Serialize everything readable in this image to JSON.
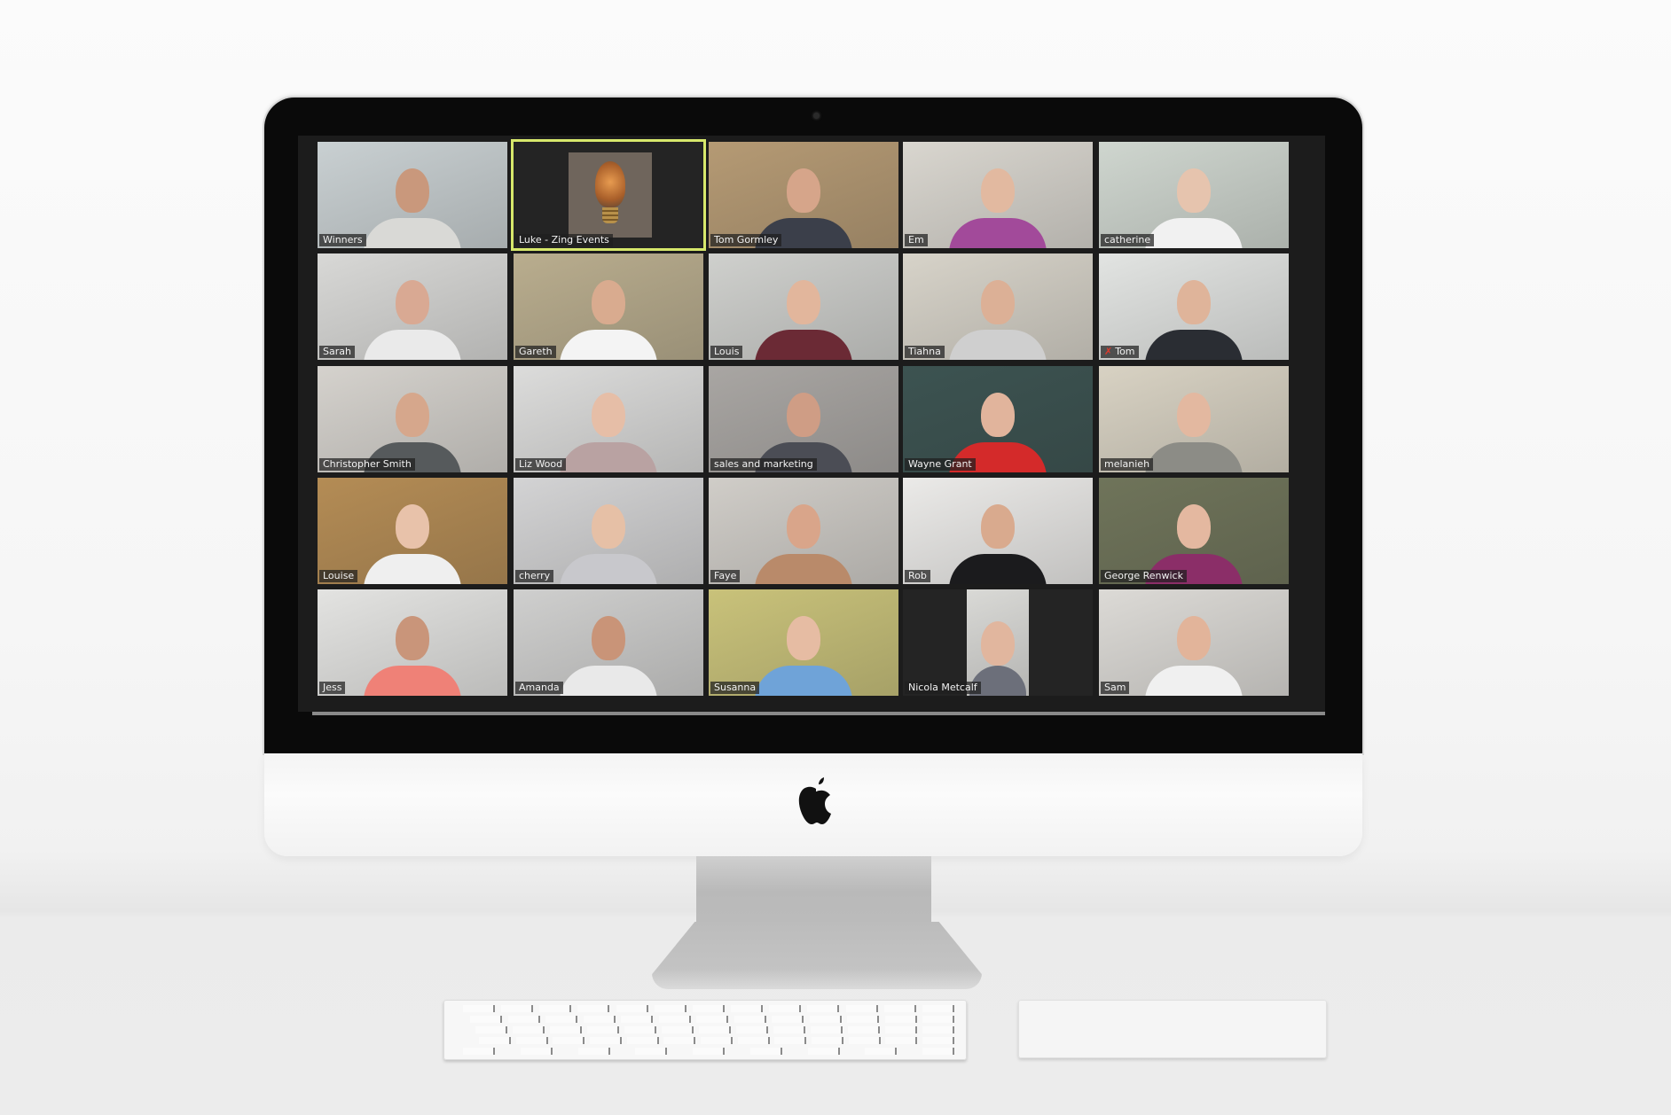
{
  "app": {
    "name": "Zoom meeting gallery view",
    "active_speaker": "Luke - Zing Events",
    "accent_color": "#d7e86b",
    "muted_icon_color": "#e0392b"
  },
  "participants": [
    {
      "name": "Winners",
      "muted": false,
      "bg": "#c9d0d2",
      "skin": "#c9987c",
      "shirt": "#d9d9d6"
    },
    {
      "name": "Luke - Zing Events",
      "muted": false,
      "active_speaker": true,
      "avatar": "lightbulb-image"
    },
    {
      "name": "Tom Gormley",
      "muted": false,
      "bg": "#b59a74",
      "skin": "#d6a58a",
      "shirt": "#3b3f4a"
    },
    {
      "name": "Em",
      "muted": false,
      "bg": "#d9d6cf",
      "skin": "#e2b9a0",
      "shirt": "#a24a9a"
    },
    {
      "name": "catherine",
      "muted": false,
      "bg": "#cfd6cf",
      "skin": "#e6c4ae",
      "shirt": "#f1f1f1"
    },
    {
      "name": "Sarah",
      "muted": false,
      "bg": "#d8d8d6",
      "skin": "#d9a993",
      "shirt": "#eaeaea"
    },
    {
      "name": "Gareth",
      "muted": false,
      "bg": "#b9ad8e",
      "skin": "#d9ab8f",
      "shirt": "#f4f4f4"
    },
    {
      "name": "Louis",
      "muted": false,
      "bg": "#cfd0cd",
      "skin": "#e2b69c",
      "shirt": "#6b2a35"
    },
    {
      "name": "Tiahna",
      "muted": false,
      "bg": "#d7d3c9",
      "skin": "#dcb096",
      "shirt": "#cfcfcf"
    },
    {
      "name": "Tom",
      "muted": true,
      "bg": "#e2e4e2",
      "skin": "#dfb49a",
      "shirt": "#2a2d33"
    },
    {
      "name": "Christopher Smith",
      "muted": false,
      "bg": "#d5d2cd",
      "skin": "#d6a78c",
      "shirt": "#565a5c"
    },
    {
      "name": "Liz Wood",
      "muted": false,
      "bg": "#dcdcdb",
      "skin": "#e6bea7",
      "shirt": "#b9a2a2"
    },
    {
      "name": "sales and marketing",
      "muted": false,
      "bg": "#a9a6a3",
      "skin": "#cf9d85",
      "shirt": "#4b4d55"
    },
    {
      "name": "Wayne Grant",
      "muted": false,
      "bg": "#3c5351",
      "skin": "#e1b49c",
      "shirt": "#d42a2a"
    },
    {
      "name": "melanieh",
      "muted": false,
      "bg": "#d8d2c3",
      "skin": "#e3b8a0",
      "shirt": "#8c8c86"
    },
    {
      "name": "Louise",
      "muted": false,
      "bg": "#b48c55",
      "skin": "#e8c2aa",
      "shirt": "#efefef"
    },
    {
      "name": "cherry",
      "muted": false,
      "bg": "#d3d3d4",
      "skin": "#e6c0a6",
      "shirt": "#c8c8cc"
    },
    {
      "name": "Faye",
      "muted": false,
      "bg": "#d0cdc8",
      "skin": "#d9a58a",
      "shirt": "#b98a6a"
    },
    {
      "name": "Rob",
      "muted": false,
      "bg": "#ebeae8",
      "skin": "#d9aa8e",
      "shirt": "#1b1b1d"
    },
    {
      "name": "George Renwick",
      "muted": false,
      "bg": "#6f745a",
      "skin": "#e4b8a0",
      "shirt": "#8b2e68"
    },
    {
      "name": "Jess",
      "muted": false,
      "bg": "#e3e3e1",
      "skin": "#c9957a",
      "shirt": "#ef8177"
    },
    {
      "name": "Amanda",
      "muted": false,
      "bg": "#cfcfce",
      "skin": "#c99478",
      "shirt": "#e9e9e9"
    },
    {
      "name": "Susanna",
      "muted": false,
      "bg": "#c9c27a",
      "skin": "#e6bca3",
      "shirt": "#6fa3d8"
    },
    {
      "name": "Nicola Metcalf",
      "muted": false,
      "bg": "#d9d9d6",
      "skin": "#e1b69e",
      "shirt": "#6c6f7a",
      "narrow": true
    },
    {
      "name": "Sam",
      "muted": false,
      "bg": "#dcdad6",
      "skin": "#e2b49a",
      "shirt": "#f0f0f0"
    }
  ],
  "hardware": {
    "logo": "apple-logo"
  }
}
